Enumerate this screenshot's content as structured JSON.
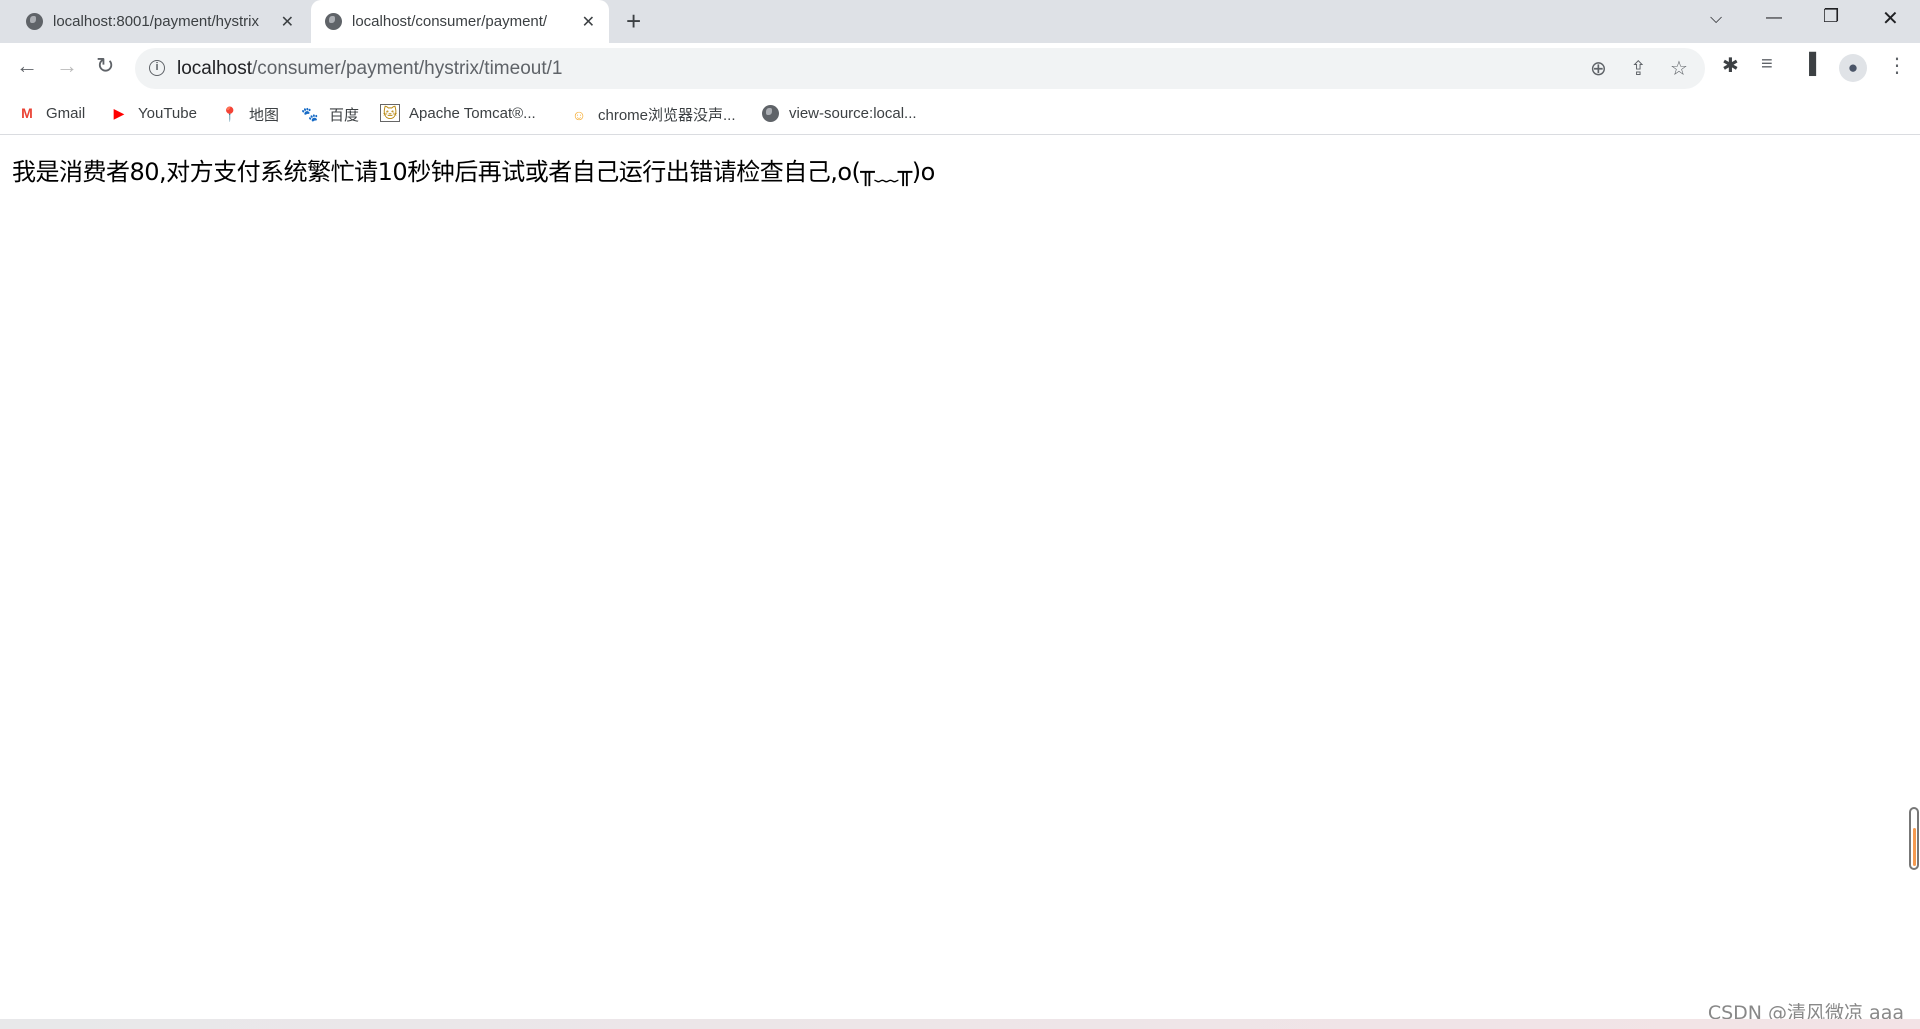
{
  "tabs": [
    {
      "title": "localhost:8001/payment/hystrix",
      "close": "✕",
      "active": false
    },
    {
      "title": "localhost/consumer/payment/",
      "close": "✕",
      "active": true
    }
  ],
  "new_tab": "+",
  "window_controls": {
    "tab_search": "⌵",
    "minimize": "—",
    "restore": "❐",
    "close": "✕"
  },
  "address_bar": {
    "host": "localhost",
    "path": "/consumer/payment/hystrix/timeout/1"
  },
  "bookmarks": [
    {
      "label": "Gmail",
      "icon": "gmail-icon"
    },
    {
      "label": "YouTube",
      "icon": "youtube-icon"
    },
    {
      "label": "地图",
      "icon": "maps-icon"
    },
    {
      "label": "百度",
      "icon": "baidu-icon"
    },
    {
      "label": "Apache Tomcat®...",
      "icon": "tomcat-icon"
    },
    {
      "label": "chrome浏览器没声...",
      "icon": "smiley-icon"
    },
    {
      "label": "view-source:local...",
      "icon": "globe-icon"
    }
  ],
  "page": {
    "message": "我是消费者80,对方支付系统繁忙请10秒钟后再试或者自己运行出错请检查自己,o(╥﹏╥)o"
  },
  "watermark": "CSDN @清风微凉 aaa",
  "colors": {
    "tabbar": "#dee1e6",
    "omnibox": "#f1f3f4",
    "scroll_accent": "#f59a50"
  }
}
